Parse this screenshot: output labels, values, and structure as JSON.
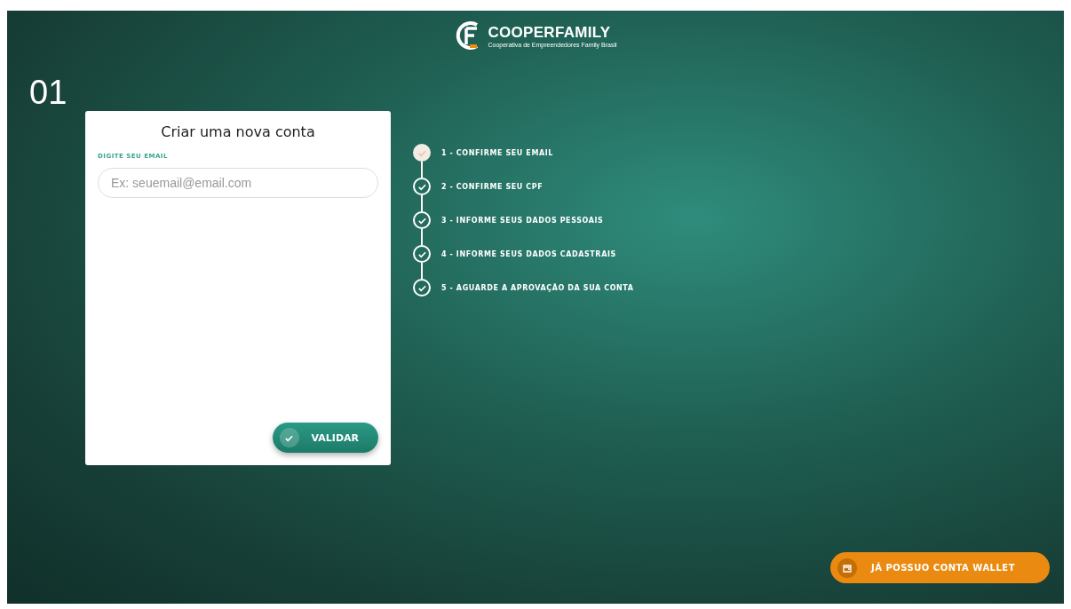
{
  "logo": {
    "name": "COOPERFAMILY",
    "tagline": "Cooperativa de Empreendedores Family Brasil"
  },
  "page_number": "01",
  "form": {
    "title": "Criar uma nova conta",
    "email_label": "DIGITE SEU EMAIL",
    "email_placeholder": "Ex: seuemail@email.com",
    "submit": "VALIDAR"
  },
  "steps": [
    {
      "label": "1 - CONFIRME SEU EMAIL",
      "selected": true,
      "checked": true
    },
    {
      "label": "2 - CONFIRME SEU CPF",
      "selected": false,
      "checked": true
    },
    {
      "label": "3 - INFORME SEUS DADOS PESSOAIS",
      "selected": false,
      "checked": true
    },
    {
      "label": "4 - INFORME SEUS DADOS CADASTRAIS",
      "selected": false,
      "checked": true
    },
    {
      "label": "5 - AGUARDE A APROVAÇÃO DA SUA CONTA",
      "selected": false,
      "checked": true
    }
  ],
  "wallet_button": "JÁ POSSUO CONTA WALLET"
}
